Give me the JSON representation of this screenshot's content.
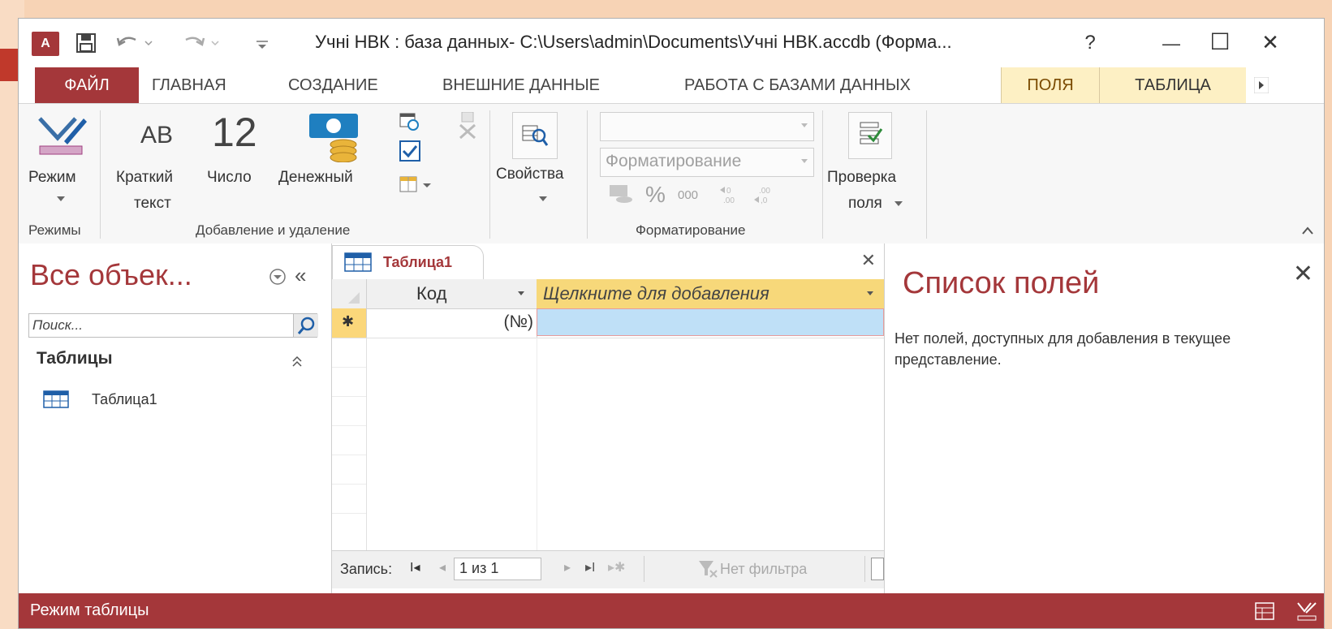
{
  "window": {
    "title": "Учні НВК : база данных- C:\\Users\\admin\\Documents\\Учні НВК.accdb (Форма...",
    "app_logo": "A",
    "help": "?",
    "minimize": "—",
    "maximize": "☐",
    "close": "✕"
  },
  "ribbon_tabs": [
    {
      "label": "ФАЙЛ"
    },
    {
      "label": "ГЛАВНАЯ"
    },
    {
      "label": "СОЗДАНИЕ"
    },
    {
      "label": "ВНЕШНИЕ ДАННЫЕ"
    },
    {
      "label": "РАБОТА С БАЗАМИ ДАННЫХ"
    },
    {
      "label": "ПОЛЯ"
    },
    {
      "label": "ТАБЛИЦА"
    }
  ],
  "ribbon": {
    "mode_label": "Режим",
    "short_text_line1": "Краткий",
    "short_text_line2": "текст",
    "short_text_icon": "AB",
    "number_label": "Число",
    "number_icon": "12",
    "currency_label": "Денежный",
    "properties_label": "Свойства",
    "format_dropdown_label": "Форматирование",
    "percent_label": "%",
    "thousands_label": "000",
    "check_line1": "Проверка",
    "check_line2": "поля",
    "groups": {
      "modes": "Режимы",
      "add_delete": "Добавление и удаление",
      "formatting": "Форматирование"
    }
  },
  "nav": {
    "title": "Все объек...",
    "search_placeholder": "Поиск...",
    "group": "Таблицы",
    "items": [
      {
        "label": "Таблица1"
      }
    ]
  },
  "document": {
    "tab_label": "Таблица1",
    "columns": [
      {
        "label": "Код"
      },
      {
        "label": "Щелкните для добавления"
      }
    ],
    "new_row_marker": "✱",
    "new_row_code": "(№)",
    "record_label": "Запись:",
    "record_position": "1 из 1",
    "filter_label": "Нет фильтра"
  },
  "field_list": {
    "title": "Список полей",
    "message": "Нет полей, доступных для добавления в текущее представление."
  },
  "status": {
    "text": "Режим таблицы"
  },
  "colors": {
    "accent": "#a4373a",
    "context_tab": "#fdf0c4",
    "header_add": "#f7d87a",
    "selected_cell": "#bfe0f7"
  }
}
